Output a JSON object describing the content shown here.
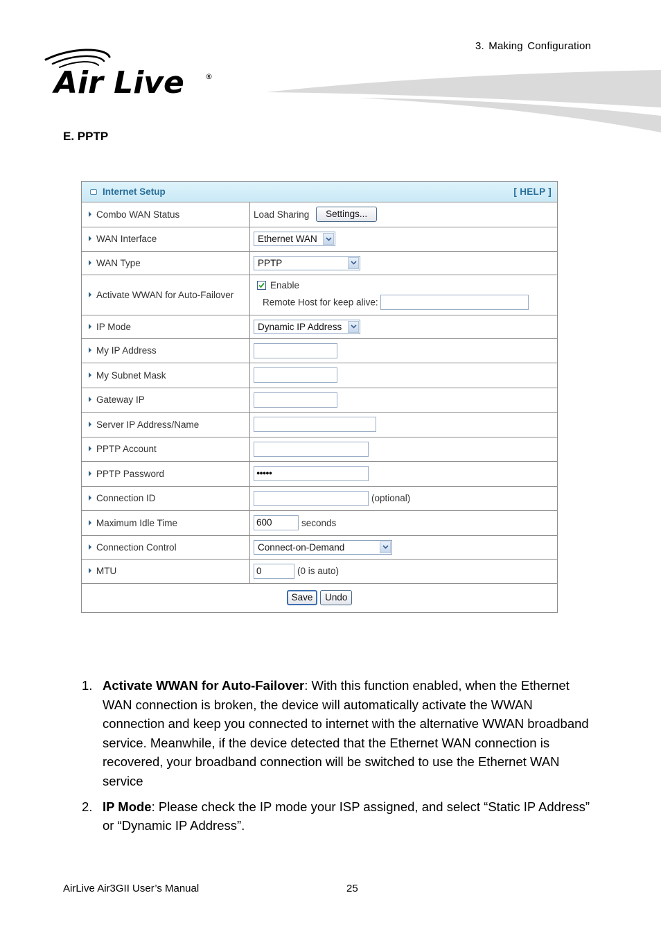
{
  "header": {
    "chapter": "3.  Making  Configuration",
    "logo_text": "Air Live",
    "logo_mark": "®"
  },
  "section_title": "E. PPTP",
  "panel": {
    "title": "Internet Setup",
    "help": "[ HELP ]",
    "accent_color": "#2a6f9a",
    "rows": {
      "combo_wan_status": {
        "label": "Combo WAN Status",
        "value": "Load Sharing",
        "button": "Settings..."
      },
      "wan_interface": {
        "label": "WAN Interface",
        "selected": "Ethernet WAN"
      },
      "wan_type": {
        "label": "WAN Type",
        "selected": "PPTP"
      },
      "auto_failover": {
        "label": "Activate WWAN for Auto-Failover",
        "checkbox_label": "Enable",
        "checked": true,
        "remote_host_label": "Remote Host for keep alive:",
        "remote_host_value": ""
      },
      "ip_mode": {
        "label": "IP Mode",
        "selected": "Dynamic IP Address"
      },
      "my_ip": {
        "label": "My IP Address",
        "value": ""
      },
      "subnet": {
        "label": "My Subnet Mask",
        "value": ""
      },
      "gateway": {
        "label": "Gateway IP",
        "value": ""
      },
      "server": {
        "label": "Server IP Address/Name",
        "value": ""
      },
      "account": {
        "label": "PPTP Account",
        "value": ""
      },
      "password": {
        "label": "PPTP Password",
        "value": "●●●●●"
      },
      "connection_id": {
        "label": "Connection ID",
        "value": "",
        "note": "(optional)"
      },
      "idle_time": {
        "label": "Maximum Idle Time",
        "value": "600",
        "note": "seconds"
      },
      "connection_control": {
        "label": "Connection Control",
        "selected": "Connect-on-Demand"
      },
      "mtu": {
        "label": "MTU",
        "value": "0",
        "note": "(0 is auto)"
      }
    },
    "save_label": "Save",
    "undo_label": "Undo"
  },
  "notes": [
    {
      "num": "1.",
      "term": "Activate WWAN for Auto-Failover",
      "text": ": With this function enabled, when the Ethernet WAN connection is broken, the device will automatically activate the WWAN connection and keep you connected to internet with the alternative WWAN broadband service. Meanwhile, if the device detected that the Ethernet WAN connection is recovered, your broadband connection will be switched to use the Ethernet WAN service"
    },
    {
      "num": "2.",
      "term": "IP Mode",
      "text": ": Please check the IP mode your ISP assigned, and select “Static IP Address” or “Dynamic IP Address”."
    }
  ],
  "footer": {
    "manual": "AirLive Air3GII User’s Manual",
    "page": "25"
  }
}
